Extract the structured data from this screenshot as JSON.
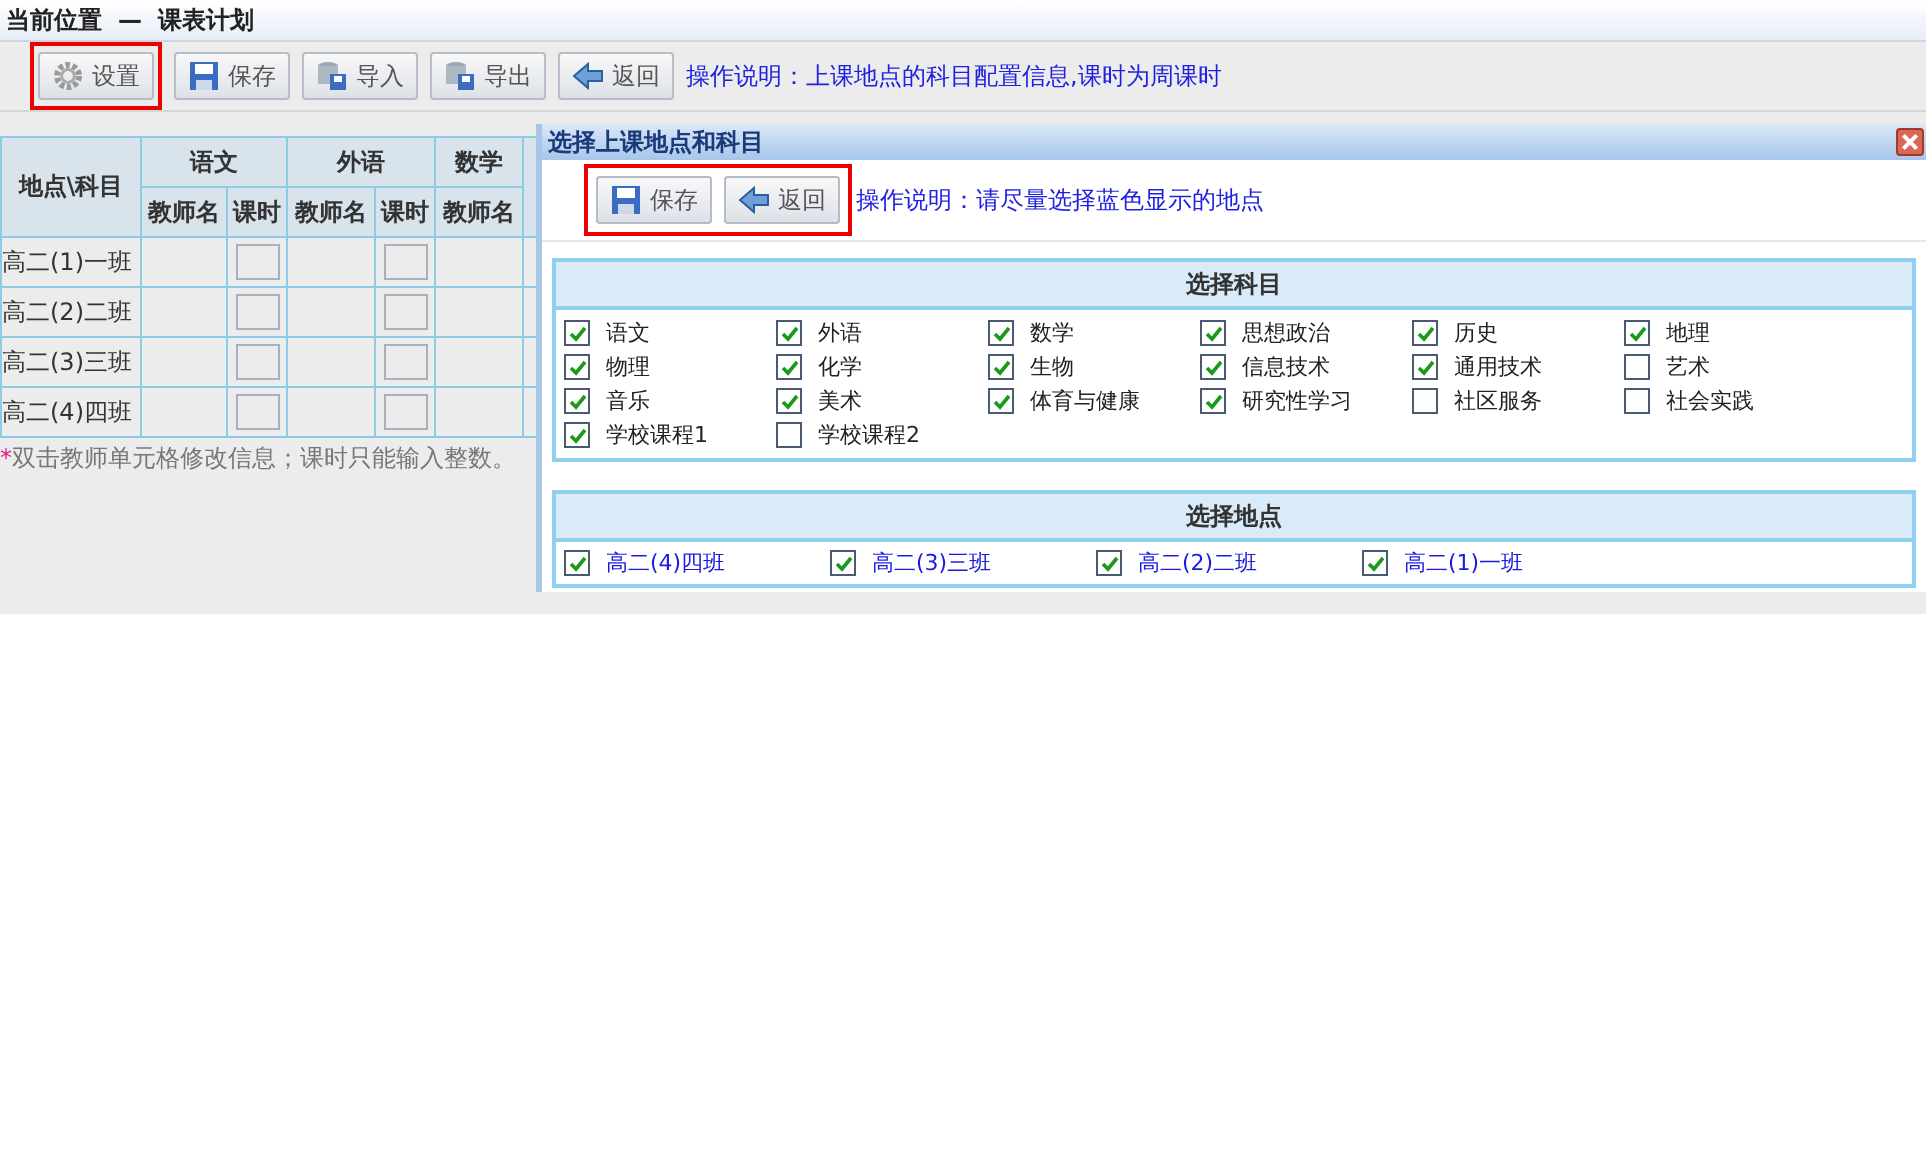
{
  "breadcrumb": {
    "label": "当前位置",
    "separator": "—",
    "page": "课表计划"
  },
  "toolbar": {
    "buttons": [
      {
        "label": "设置",
        "kind": "settings",
        "highlighted": true
      },
      {
        "label": "保存",
        "kind": "save",
        "highlighted": false
      },
      {
        "label": "导入",
        "kind": "import",
        "highlighted": false
      },
      {
        "label": "导出",
        "kind": "export",
        "highlighted": false
      },
      {
        "label": "返回",
        "kind": "back",
        "highlighted": false
      }
    ],
    "instruction": "操作说明：上课地点的科目配置信息,课时为周课时"
  },
  "table": {
    "corner": "地点\\科目",
    "subjects": [
      {
        "name": "语文",
        "columns": [
          "教师名",
          "课时"
        ]
      },
      {
        "name": "外语",
        "columns": [
          "教师名",
          "课时"
        ]
      },
      {
        "name": "数学",
        "columns": [
          "教师名"
        ]
      }
    ],
    "rows": [
      "高二(1)一班",
      "高二(2)二班",
      "高二(3)三班",
      "高二(4)四班"
    ],
    "note_mark": "*",
    "note": "双击教师单元格修改信息；课时只能输入整数。"
  },
  "dialog": {
    "title": "选择上课地点和科目",
    "buttons": [
      {
        "label": "保存",
        "kind": "save"
      },
      {
        "label": "返回",
        "kind": "back"
      }
    ],
    "buttons_highlighted": true,
    "instruction": "操作说明：请尽量选择蓝色显示的地点",
    "subjects_title": "选择科目",
    "subjects": [
      {
        "label": "语文",
        "checked": true
      },
      {
        "label": "外语",
        "checked": true
      },
      {
        "label": "数学",
        "checked": true
      },
      {
        "label": "思想政治",
        "checked": true
      },
      {
        "label": "历史",
        "checked": true
      },
      {
        "label": "地理",
        "checked": true
      },
      {
        "label": "物理",
        "checked": true
      },
      {
        "label": "化学",
        "checked": true
      },
      {
        "label": "生物",
        "checked": true
      },
      {
        "label": "信息技术",
        "checked": true
      },
      {
        "label": "通用技术",
        "checked": true
      },
      {
        "label": "艺术",
        "checked": false
      },
      {
        "label": "音乐",
        "checked": true
      },
      {
        "label": "美术",
        "checked": true
      },
      {
        "label": "体育与健康",
        "checked": true
      },
      {
        "label": "研究性学习",
        "checked": true
      },
      {
        "label": "社区服务",
        "checked": false
      },
      {
        "label": "社会实践",
        "checked": false
      },
      {
        "label": "学校课程1",
        "checked": true
      },
      {
        "label": "学校课程2",
        "checked": false
      }
    ],
    "places_title": "选择地点",
    "places": [
      {
        "label": "高二(4)四班",
        "checked": true
      },
      {
        "label": "高二(3)三班",
        "checked": true
      },
      {
        "label": "高二(2)二班",
        "checked": true
      },
      {
        "label": "高二(1)一班",
        "checked": true
      }
    ]
  }
}
